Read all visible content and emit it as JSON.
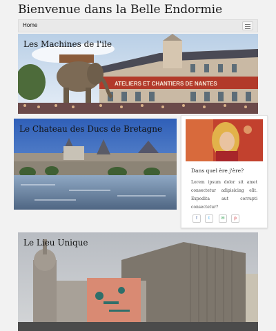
{
  "site": {
    "title": "Bienvenue dans la Belle Endormie"
  },
  "nav": {
    "home_label": "Home"
  },
  "cards": [
    {
      "title": "Les Machines de l'ile",
      "sign": "ATELIERS ET CHANTIERS DE NANTES"
    },
    {
      "title": "Le Chateau des Ducs de Bretagne"
    },
    {
      "title": "Le Lieu Unique"
    }
  ],
  "aside": {
    "title": "Dans quel ère j'ère?",
    "text": "Lorem ipsum dolor sit amet consectetur adipisicing elit. Expedita aut corrupti consectetur?",
    "share": [
      {
        "icon": "facebook-icon",
        "glyph": "f",
        "color": "#3b5998"
      },
      {
        "icon": "twitter-icon",
        "glyph": "t",
        "color": "#1da1f2"
      },
      {
        "icon": "email-icon",
        "glyph": "✉",
        "color": "#2e9e4f"
      },
      {
        "icon": "pinterest-icon",
        "glyph": "p",
        "color": "#cb2027"
      }
    ]
  }
}
